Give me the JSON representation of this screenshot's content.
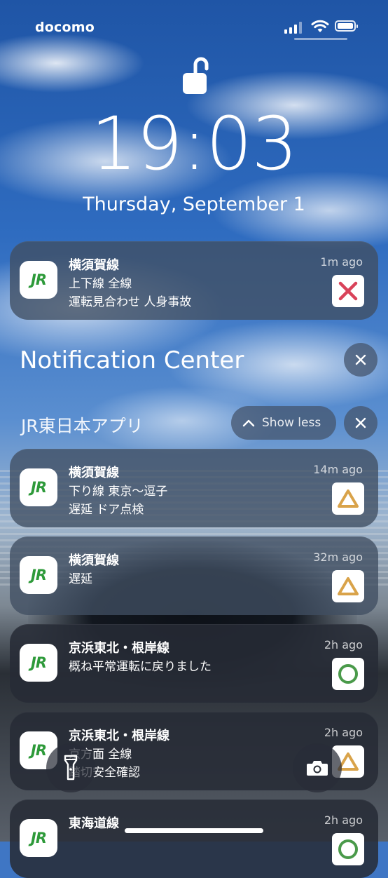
{
  "status_bar": {
    "carrier": "docomo"
  },
  "lock_screen": {
    "time": "19:03",
    "date": "Thursday, September 1"
  },
  "pinned_notification": {
    "title": "横須賀線",
    "line1": "上下線 全線",
    "line2": "運転見合わせ 人身事故",
    "ago": "1m ago",
    "status_icon": "cross",
    "status_color": "#d9435a"
  },
  "notification_center": {
    "title": "Notification Center"
  },
  "group": {
    "app_name": "JR東日本アプリ",
    "show_less_label": "Show less",
    "notifications": [
      {
        "title": "横須賀線",
        "line1": "下り線 東京〜逗子",
        "line2": "遅延 ドア点検",
        "ago": "14m ago",
        "status_icon": "triangle",
        "status_color": "#d9a34a"
      },
      {
        "title": "横須賀線",
        "line1": "遅延",
        "line2": "",
        "ago": "32m ago",
        "status_icon": "triangle",
        "status_color": "#d9a34a"
      },
      {
        "title": "京浜東北・根岸線",
        "line1": "概ね平常運転に戻りました",
        "line2": "",
        "ago": "2h ago",
        "status_icon": "circle",
        "status_color": "#4a9a4a"
      },
      {
        "title": "京浜東北・根岸線",
        "line1": "京方面 全線",
        "line2": "踏切安全確認",
        "ago": "2h ago",
        "status_icon": "triangle",
        "status_color": "#d9a34a"
      },
      {
        "title": "東海道線",
        "line1": "",
        "line2": "",
        "ago": "2h ago",
        "status_icon": "circle",
        "status_color": "#4a9a4a"
      }
    ]
  },
  "app_icon_text": "JR",
  "app_icon_color": "#2e9a3a"
}
